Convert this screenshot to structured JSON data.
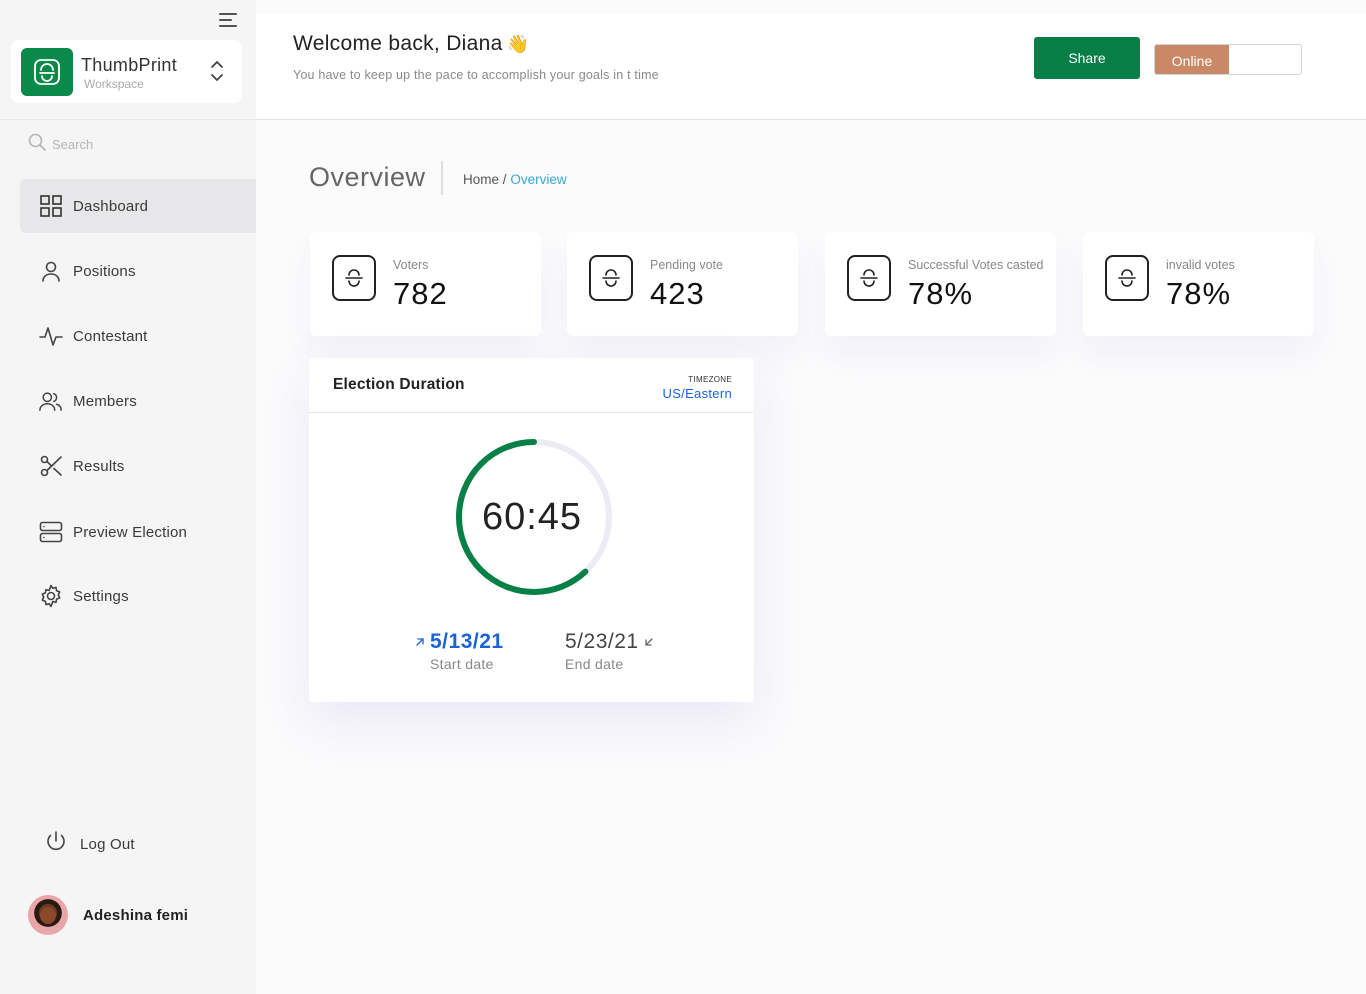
{
  "sidebar": {
    "workspace": {
      "name": "ThumbPrint",
      "subtitle": "Workspace"
    },
    "search_placeholder": "Search",
    "nav": [
      {
        "label": "Dashboard",
        "icon": "grid-icon",
        "active": true
      },
      {
        "label": "Positions",
        "icon": "user-icon"
      },
      {
        "label": "Contestant",
        "icon": "activity-icon"
      },
      {
        "label": "Members",
        "icon": "users-icon"
      },
      {
        "label": "Results",
        "icon": "scissors-icon"
      },
      {
        "label": "Preview Election",
        "icon": "server-icon"
      },
      {
        "label": "Settings",
        "icon": "gear-icon"
      }
    ],
    "logout_label": "Log Out",
    "user_name": "Adeshina femi"
  },
  "header": {
    "welcome": "Welcome back, Diana",
    "wave_emoji": "👋",
    "subtitle": "You have to keep up the pace to accomplish your goals in t time",
    "share_label": "Share",
    "status_label": "Online"
  },
  "main": {
    "title": "Overview",
    "breadcrumb": {
      "home": "Home",
      "separator": "/",
      "current": "Overview"
    },
    "stats": [
      {
        "label": "Voters",
        "value": "782"
      },
      {
        "label": "Pending vote",
        "value": "423"
      },
      {
        "label": "Successful Votes casted",
        "value": "78%"
      },
      {
        "label": "invalid votes",
        "value": "78%"
      }
    ],
    "duration": {
      "title": "Election Duration",
      "timezone_label": "TIMEZONE",
      "timezone": "US/Eastern",
      "time": "60:45",
      "progress": 0.62,
      "start_date": "5/13/21",
      "start_caption": "Start date",
      "end_date": "5/23/21",
      "end_caption": "End date"
    }
  },
  "colors": {
    "brand_green": "#067e45",
    "online_toggle": "#c98866",
    "link_blue": "#1a62d8",
    "breadcrumb_active": "#3ba7d6"
  }
}
